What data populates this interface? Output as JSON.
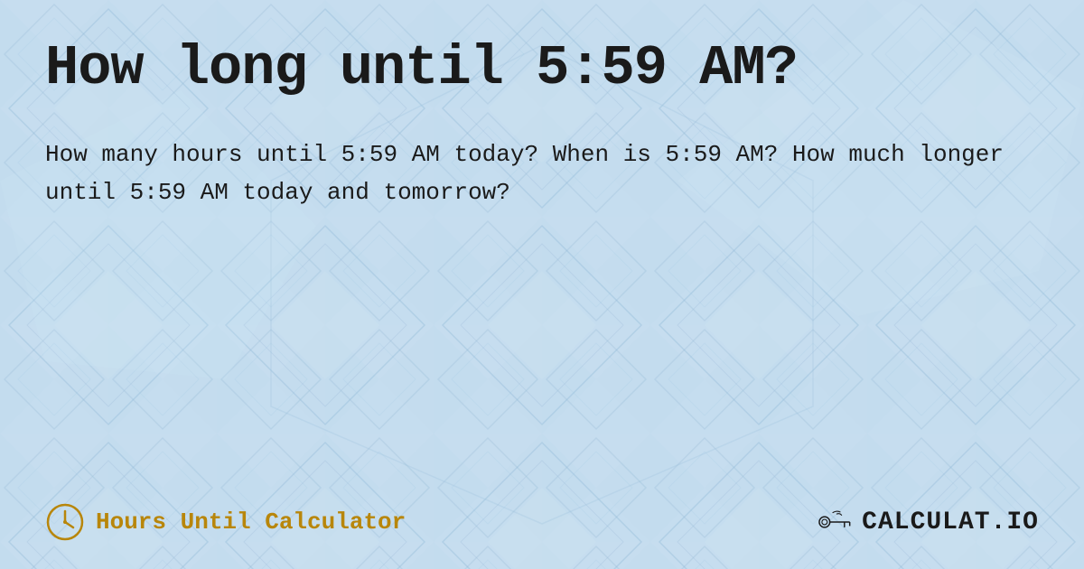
{
  "page": {
    "title": "How long until 5:59 AM?",
    "description": "How many hours until 5:59 AM today? When is 5:59 AM? How much longer until 5:59 AM today and tomorrow?",
    "background_color": "#c8dff0",
    "text_color": "#1a1a1a"
  },
  "footer": {
    "hours_until_label": "Hours Until Calculator",
    "logo_text": "CALCULAT.IO"
  }
}
